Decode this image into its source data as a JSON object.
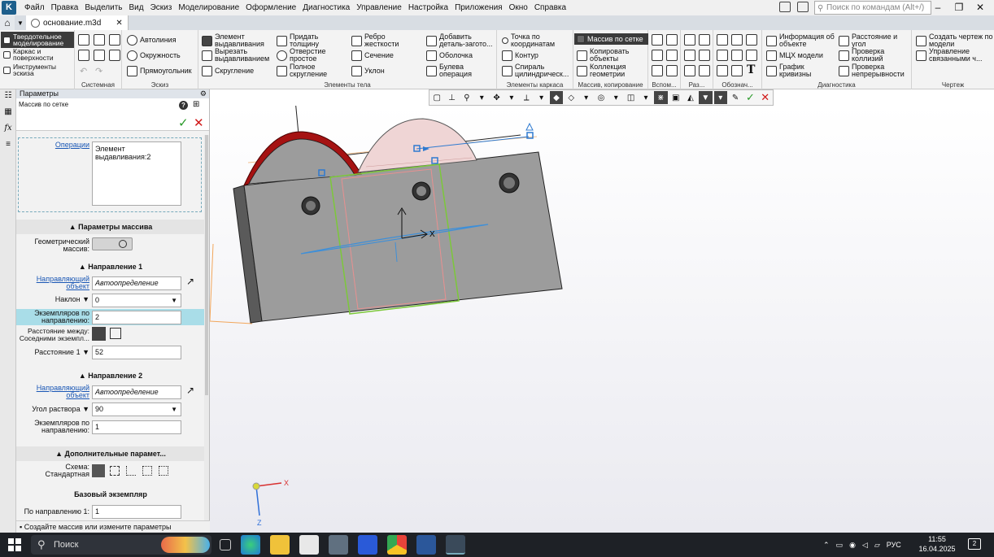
{
  "app": {
    "menu": [
      "Файл",
      "Правка",
      "Выделить",
      "Вид",
      "Эскиз",
      "Моделирование",
      "Оформление",
      "Диагностика",
      "Управление",
      "Настройка",
      "Приложения",
      "Окно",
      "Справка"
    ],
    "search_placeholder": "Поиск по командам (Alt+/)"
  },
  "tabs": {
    "doc": "основание.m3d"
  },
  "ribbon": {
    "modes": [
      "Твердотельное моделирование",
      "Каркас и поверхности",
      "Инструменты эскиза"
    ],
    "groups": {
      "system": "Системная",
      "sketch": "Эскиз",
      "body": "Элементы тела",
      "frame": "Элементы каркаса",
      "array": "Массив, копирование",
      "aux": "Вспом...",
      "size": "Раз...",
      "notation": "Обознач...",
      "diag": "Диагностика",
      "drawing": "Чертеж"
    },
    "sketch_items": [
      "Автолиния",
      "Окружность",
      "Прямоугольник"
    ],
    "body_items": [
      "Элемент выдавливания",
      "Вырезать выдавливанием",
      "Скругление",
      "Придать толщину",
      "Отверстие простое",
      "Полное скругление",
      "Ребро жесткости",
      "Сечение",
      "Уклон",
      "Добавить деталь-загото...",
      "Оболочка",
      "Булева операция"
    ],
    "frame_items": [
      "Точка по координатам",
      "Контур",
      "Спираль цилиндрическ..."
    ],
    "array_items": [
      "Массив по сетке",
      "Копировать объекты",
      "Коллекция геометрии"
    ],
    "diag_items": [
      "Информация об объекте",
      "МЦХ модели",
      "График кривизны",
      "Расстояние и угол",
      "Проверка коллизий",
      "Проверка непрерывности"
    ],
    "drawing_items": [
      "Создать чертеж по модели",
      "Управление связанными ч..."
    ]
  },
  "panel": {
    "title": "Параметры",
    "command": "Массив по сетке",
    "operations_label": "Операции",
    "operations_value": "Элемент выдавливания:2",
    "section_array": "Параметры массива",
    "geom_label": "Геометрический массив:",
    "dir1_title": "Направление 1",
    "dir1_obj_label": "Направляющий объект",
    "dir1_obj_value": "Автоопределение",
    "tilt_label": "Наклон",
    "tilt_value": "0",
    "count1_label": "Экземпляров по направлению:",
    "count1_value": "2",
    "dist_between_label": "Расстояние между:",
    "dist_between_value": "Соседними экземпл...",
    "dist1_label": "Расстояние 1",
    "dist1_value": "52",
    "dir2_title": "Направление 2",
    "dir2_obj_label": "Направляющий объект",
    "dir2_obj_value": "Автоопределение",
    "angle_label": "Угол раствора",
    "angle_value": "90",
    "count2_label": "Экземпляров по направлению:",
    "count2_value": "1",
    "section_extra": "Дополнительные парамет...",
    "scheme_label": "Схема:",
    "scheme_value": "Стандартная",
    "base_title": "Базовый экземпляр",
    "base_dir1_label": "По направлению 1:",
    "base_dir1_value": "1"
  },
  "status": "Создайте массив или измените параметры",
  "axis_label": "X",
  "triad": {
    "x": "X",
    "z": "Z"
  },
  "taskbar": {
    "search": "Поиск",
    "lang": "РУС",
    "time": "11:55",
    "date": "16.04.2025",
    "notifications": "2"
  }
}
